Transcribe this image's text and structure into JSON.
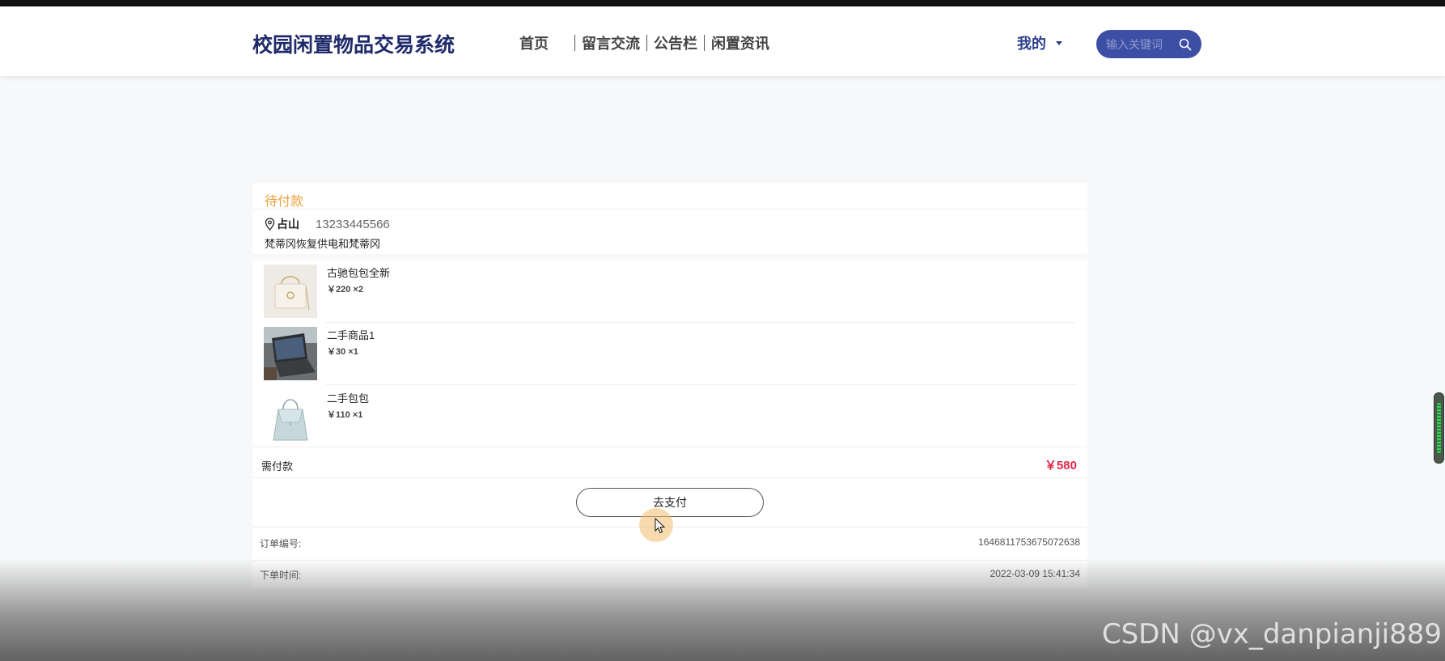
{
  "header": {
    "logo": "校园闲置物品交易系统",
    "nav": [
      "首页",
      "留言交流",
      "公告栏",
      "闲置资讯"
    ],
    "mine": "我的",
    "search_placeholder": "输入关键词"
  },
  "order": {
    "status": "待付款",
    "receiver_name": "占山",
    "receiver_phone": "13233445566",
    "address": "梵蒂冈恢复供电和梵蒂冈",
    "items": [
      {
        "name": "古驰包包全新",
        "price": "￥220 ×2",
        "thumb": "white-handbag"
      },
      {
        "name": "二手商品1",
        "price": "￥30 ×1",
        "thumb": "laptop"
      },
      {
        "name": "二手包包",
        "price": "￥110 ×1",
        "thumb": "blue-handbag"
      }
    ],
    "due_label": "需付款",
    "due_value": "￥580",
    "pay_button": "去支付",
    "order_no_label": "订单编号:",
    "order_no": "1646811753675072638",
    "order_time_label": "下单时间:",
    "order_time": "2022-03-09 15:41:34"
  },
  "watermark": "CSDN @vx_danpianji889",
  "colors": {
    "brand": "#1f2a6b",
    "status": "#e6a23c",
    "price_due": "#e0284a",
    "search_bg": "#3d4fa5"
  }
}
